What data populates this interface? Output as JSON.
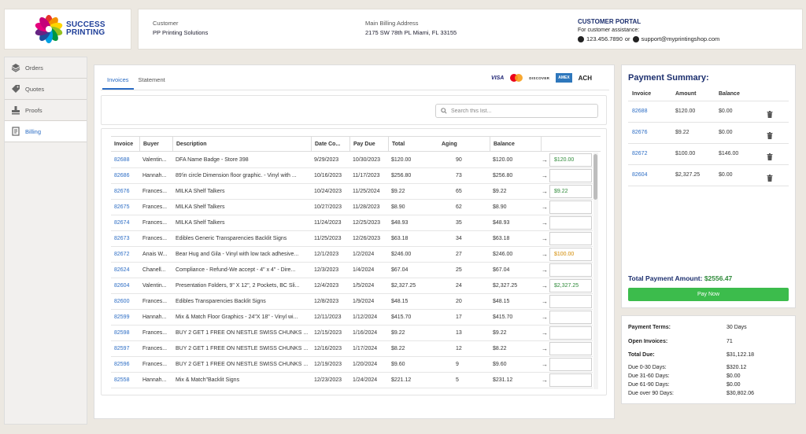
{
  "brand": {
    "logo_line1": "SUCCESS",
    "logo_line2": "PRINTING"
  },
  "header": {
    "customer_label": "Customer",
    "customer_value": "PP Printing Solutions",
    "address_label": "Main Billing Address",
    "address_value": "2175 SW 78th PL Miami, FL 33155",
    "portal_title": "CUSTOMER PORTAL",
    "portal_sub": "For customer assistance:",
    "phone": "123.456.7890",
    "or": "or",
    "email": "support@myprintingshop.com"
  },
  "sidebar": {
    "items": [
      {
        "label": "Orders",
        "icon": "layers-icon"
      },
      {
        "label": "Quotes",
        "icon": "tag-icon"
      },
      {
        "label": "Proofs",
        "icon": "stamp-icon"
      },
      {
        "label": "Billing",
        "icon": "invoice-icon"
      }
    ],
    "active": "Billing"
  },
  "tabs": {
    "invoices": "Invoices",
    "statement": "Statement"
  },
  "payment_logos": {
    "visa": "VISA",
    "discover": "DISCOVER",
    "amex": "AMEX",
    "ach": "ACH"
  },
  "search": {
    "placeholder": "Search this list..."
  },
  "table": {
    "headers": {
      "invoice": "Invoice",
      "buyer": "Buyer",
      "description": "Description",
      "date": "Date Co...",
      "pay_due": "Pay Due",
      "total": "Total",
      "aging": "Aging",
      "balance": "Balance"
    },
    "rows": [
      {
        "invoice": "82688",
        "buyer": "Valentin...",
        "description": "DFA Name Badge - Store 398",
        "date": "9/29/2023",
        "due": "10/30/2023",
        "total": "$120.00",
        "aging": "90",
        "balance": "$120.00",
        "pay": "$120.00",
        "pay_color": "green"
      },
      {
        "invoice": "82686",
        "buyer": "Hannah...",
        "description": "89'in circle Dimension floor graphic. - Vinyl with ...",
        "date": "10/16/2023",
        "due": "11/17/2023",
        "total": "$256.80",
        "aging": "73",
        "balance": "$256.80",
        "pay": "",
        "pay_color": ""
      },
      {
        "invoice": "82676",
        "buyer": "Frances...",
        "description": "MILKA Shelf Talkers",
        "date": "10/24/2023",
        "due": "11/25/2024",
        "total": "$9.22",
        "aging": "65",
        "balance": "$9.22",
        "pay": "$9.22",
        "pay_color": "green"
      },
      {
        "invoice": "82675",
        "buyer": "Frances...",
        "description": "MILKA Shelf Talkers",
        "date": "10/27/2023",
        "due": "11/28/2023",
        "total": "$8.90",
        "aging": "62",
        "balance": "$8.90",
        "pay": "",
        "pay_color": ""
      },
      {
        "invoice": "82674",
        "buyer": "Frances...",
        "description": "MILKA Shelf Talkers",
        "date": "11/24/2023",
        "due": "12/25/2023",
        "total": "$48.93",
        "aging": "35",
        "balance": "$48.93",
        "pay": "",
        "pay_color": ""
      },
      {
        "invoice": "82673",
        "buyer": "Frances...",
        "description": "Edibles Generic Transparencies Backlit Signs",
        "date": "11/25/2023",
        "due": "12/26/2023",
        "total": "$63.18",
        "aging": "34",
        "balance": "$63.18",
        "pay": "",
        "pay_color": ""
      },
      {
        "invoice": "82672",
        "buyer": "Anais W...",
        "description": "Bear Hug and Gila - Vinyl with low tack adhesive...",
        "date": "12/1/2023",
        "due": "1/2/2024",
        "total": "$246.00",
        "aging": "27",
        "balance": "$246.00",
        "pay": "$100.00",
        "pay_color": "orange"
      },
      {
        "invoice": "82624",
        "buyer": "Chanell...",
        "description": "Compliance - Refund-We accept - 4\" x 4\" - Dire...",
        "date": "12/3/2023",
        "due": "1/4/2024",
        "total": "$67.04",
        "aging": "25",
        "balance": "$67.04",
        "pay": "",
        "pay_color": ""
      },
      {
        "invoice": "82604",
        "buyer": "Valentin...",
        "description": "Presentation Folders, 9\" X 12\", 2 Pockets, BC Sli...",
        "date": "12/4/2023",
        "due": "1/5/2024",
        "total": "$2,327.25",
        "aging": "24",
        "balance": "$2,327.25",
        "pay": "$2,327.25",
        "pay_color": "green"
      },
      {
        "invoice": "82600",
        "buyer": "Frances...",
        "description": "Edibles Transparencies Backlit Signs",
        "date": "12/8/2023",
        "due": "1/9/2024",
        "total": "$48.15",
        "aging": "20",
        "balance": "$48.15",
        "pay": "",
        "pay_color": ""
      },
      {
        "invoice": "82599",
        "buyer": "Hannah...",
        "description": "Mix & Match Floor Graphics - 24\"X 18\" - Vinyl wi...",
        "date": "12/11/2023",
        "due": "1/12/2024",
        "total": "$415.70",
        "aging": "17",
        "balance": "$415.70",
        "pay": "",
        "pay_color": ""
      },
      {
        "invoice": "82598",
        "buyer": "Frances...",
        "description": "BUY 2 GET 1 FREE ON NESTLE SWISS CHUNKS ...",
        "date": "12/15/2023",
        "due": "1/16/2024",
        "total": "$9.22",
        "aging": "13",
        "balance": "$9.22",
        "pay": "",
        "pay_color": ""
      },
      {
        "invoice": "82597",
        "buyer": "Frances...",
        "description": "BUY 2 GET 1 FREE ON NESTLE SWISS CHUNKS ...",
        "date": "12/16/2023",
        "due": "1/17/2024",
        "total": "$8.22",
        "aging": "12",
        "balance": "$8.22",
        "pay": "",
        "pay_color": ""
      },
      {
        "invoice": "82596",
        "buyer": "Frances...",
        "description": "BUY 2 GET 1 FREE ON NESTLE SWISS CHUNKS ...",
        "date": "12/19/2023",
        "due": "1/20/2024",
        "total": "$9.60",
        "aging": "9",
        "balance": "$9.60",
        "pay": "",
        "pay_color": ""
      },
      {
        "invoice": "82558",
        "buyer": "Hannah...",
        "description": "Mix & Match\"Backlit Signs",
        "date": "12/23/2023",
        "due": "1/24/2024",
        "total": "$221.12",
        "aging": "5",
        "balance": "$231.12",
        "pay": "",
        "pay_color": ""
      }
    ]
  },
  "summary": {
    "title": "Payment Summary:",
    "headers": {
      "invoice": "Invoice",
      "amount": "Amount",
      "balance": "Balance"
    },
    "rows": [
      {
        "invoice": "82688",
        "amount": "$120.00",
        "balance": "$0.00"
      },
      {
        "invoice": "82676",
        "amount": "$9.22",
        "balance": "$0.00"
      },
      {
        "invoice": "82672",
        "amount": "$100.00",
        "balance": "$146.00"
      },
      {
        "invoice": "82604",
        "amount": "$2,327.25",
        "balance": "$0.00"
      }
    ],
    "total_label": "Total Payment Amount:",
    "total_value": "$2556.47",
    "pay_button": "Pay Now"
  },
  "terms": {
    "payment_terms_label": "Payment Terms:",
    "payment_terms_value": "30 Days",
    "open_invoices_label": "Open Invoices:",
    "open_invoices_value": "71",
    "total_due_label": "Total Due:",
    "total_due_value": "$31,122.18",
    "buckets": [
      {
        "label": "Due 0-30 Days:",
        "value": "$320.12"
      },
      {
        "label": "Due 31-60 Days:",
        "value": "$0.00"
      },
      {
        "label": "Due 61-90 Days:",
        "value": "$0.00"
      },
      {
        "label": "Due over 90 Days:",
        "value": "$30,802.06"
      }
    ]
  },
  "colors": {
    "accent_blue": "#2b6cc4",
    "navy": "#1c2f6e",
    "green": "#3cbc4c",
    "orange": "#d28a00"
  }
}
